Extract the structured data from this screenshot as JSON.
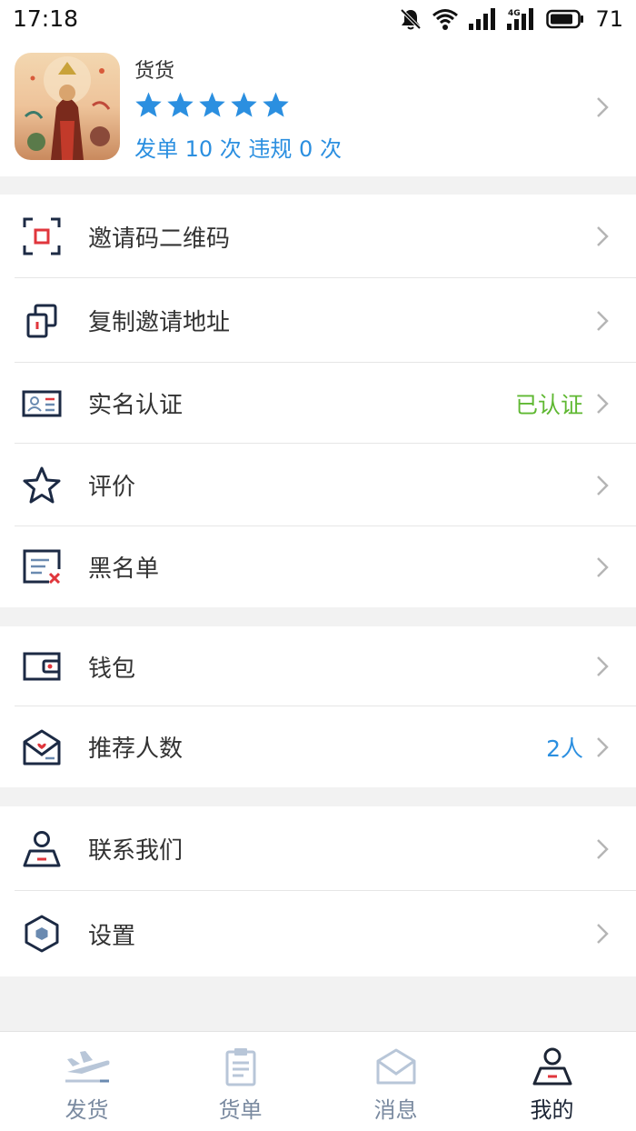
{
  "status_bar": {
    "time": "17:18",
    "battery_percent": "71",
    "icons": [
      "mute-bell-icon",
      "wifi-icon",
      "signal-icon",
      "signal-4g-icon",
      "battery-icon"
    ]
  },
  "profile": {
    "name": "货货",
    "rating_stars": 5,
    "stats": "发单 10 次 违规 0 次"
  },
  "menu_sections": [
    {
      "items": [
        {
          "label": "邀请码二维码",
          "icon": "qr-scan-icon",
          "value": ""
        },
        {
          "label": "复制邀请地址",
          "icon": "copy-icon",
          "value": ""
        },
        {
          "label": "实名认证",
          "icon": "id-card-icon",
          "value": "已认证"
        },
        {
          "label": "评价",
          "icon": "star-outline-icon",
          "value": ""
        },
        {
          "label": "黑名单",
          "icon": "blacklist-icon",
          "value": ""
        }
      ]
    },
    {
      "items": [
        {
          "label": "钱包",
          "icon": "wallet-icon",
          "value": ""
        },
        {
          "label": "推荐人数",
          "icon": "referral-mail-icon",
          "value": "2人"
        }
      ]
    },
    {
      "items": [
        {
          "label": "联系我们",
          "icon": "contact-person-icon",
          "value": ""
        },
        {
          "label": "设置",
          "icon": "settings-hex-icon",
          "value": ""
        }
      ]
    }
  ],
  "tabbar": {
    "tabs": [
      {
        "label": "发货",
        "icon": "plane-takeoff-icon",
        "active": false
      },
      {
        "label": "货单",
        "icon": "clipboard-icon",
        "active": false
      },
      {
        "label": "消息",
        "icon": "envelope-icon",
        "active": false
      },
      {
        "label": "我的",
        "icon": "person-icon",
        "active": true
      }
    ]
  },
  "colors": {
    "accent_blue": "#2b8fe0",
    "verified_green": "#5fb832",
    "icon_navy": "#1c2a44",
    "alert_red": "#e0363c"
  }
}
